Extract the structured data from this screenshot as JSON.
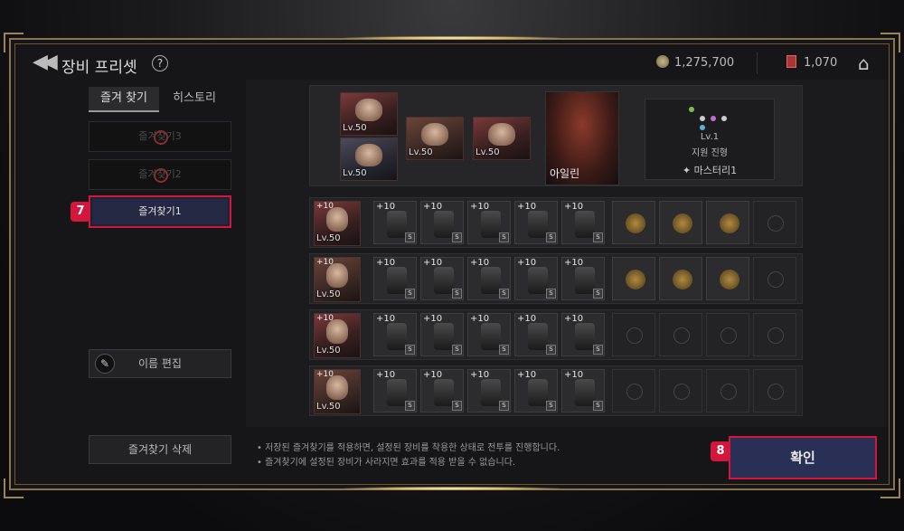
{
  "header": {
    "title": "장비 프리셋",
    "help": "?",
    "currency1": "1,275,700",
    "currency2": "1,070",
    "back_icon": "chevrons-left-icon",
    "home_icon": "home-icon"
  },
  "tabs": [
    {
      "label": "즐겨 찾기"
    },
    {
      "label": "히스토리"
    }
  ],
  "favorites": [
    {
      "label": "즐겨찾기3"
    },
    {
      "label": "즐겨찾기2"
    },
    {
      "label": "즐겨찾기1"
    }
  ],
  "badges": {
    "b7": "7",
    "b8": "8"
  },
  "buttons": {
    "edit_name": "이름 편집",
    "delete_favorite": "즐겨찾기 삭제",
    "confirm": "확인"
  },
  "team": {
    "heroes": [
      {
        "level": "Lv.50"
      },
      {
        "level": "Lv.50"
      },
      {
        "level": "Lv.50"
      },
      {
        "level": "Lv.50"
      }
    ],
    "main_hero_name": "아일린",
    "formation": {
      "level": "Lv.1",
      "name": "지원 진형",
      "mastery": "마스터리1"
    }
  },
  "rows": [
    {
      "hero_level": "Lv.50",
      "hero_top": "+10",
      "slots": [
        "+10",
        "+10",
        "+10",
        "+10",
        "+10"
      ],
      "accessories": "equipped"
    },
    {
      "hero_level": "Lv.50",
      "hero_top": "+10",
      "slots": [
        "+10",
        "+10",
        "+10",
        "+10",
        "+10"
      ],
      "accessories": "equipped"
    },
    {
      "hero_level": "Lv.50",
      "hero_top": "+10",
      "slots": [
        "+10",
        "+10",
        "+10",
        "+10",
        "+10"
      ],
      "accessories": "empty"
    },
    {
      "hero_level": "Lv.50",
      "hero_top": "+10",
      "slots": [
        "+10",
        "+10",
        "+10",
        "+10",
        "+10"
      ],
      "accessories": "empty"
    }
  ],
  "notes": [
    "• 저장된 즐겨찾기를 적용하면, 설정된 장비를 착용한 상태로 전투를 진행합니다.",
    "• 즐겨찾기에 설정된 장비가 사라지면 효과를 적용 받을 수 없습니다."
  ],
  "colors": {
    "accent": "#d4163c",
    "frame": "#8a7450",
    "confirm_bg": "#2a2f55"
  }
}
